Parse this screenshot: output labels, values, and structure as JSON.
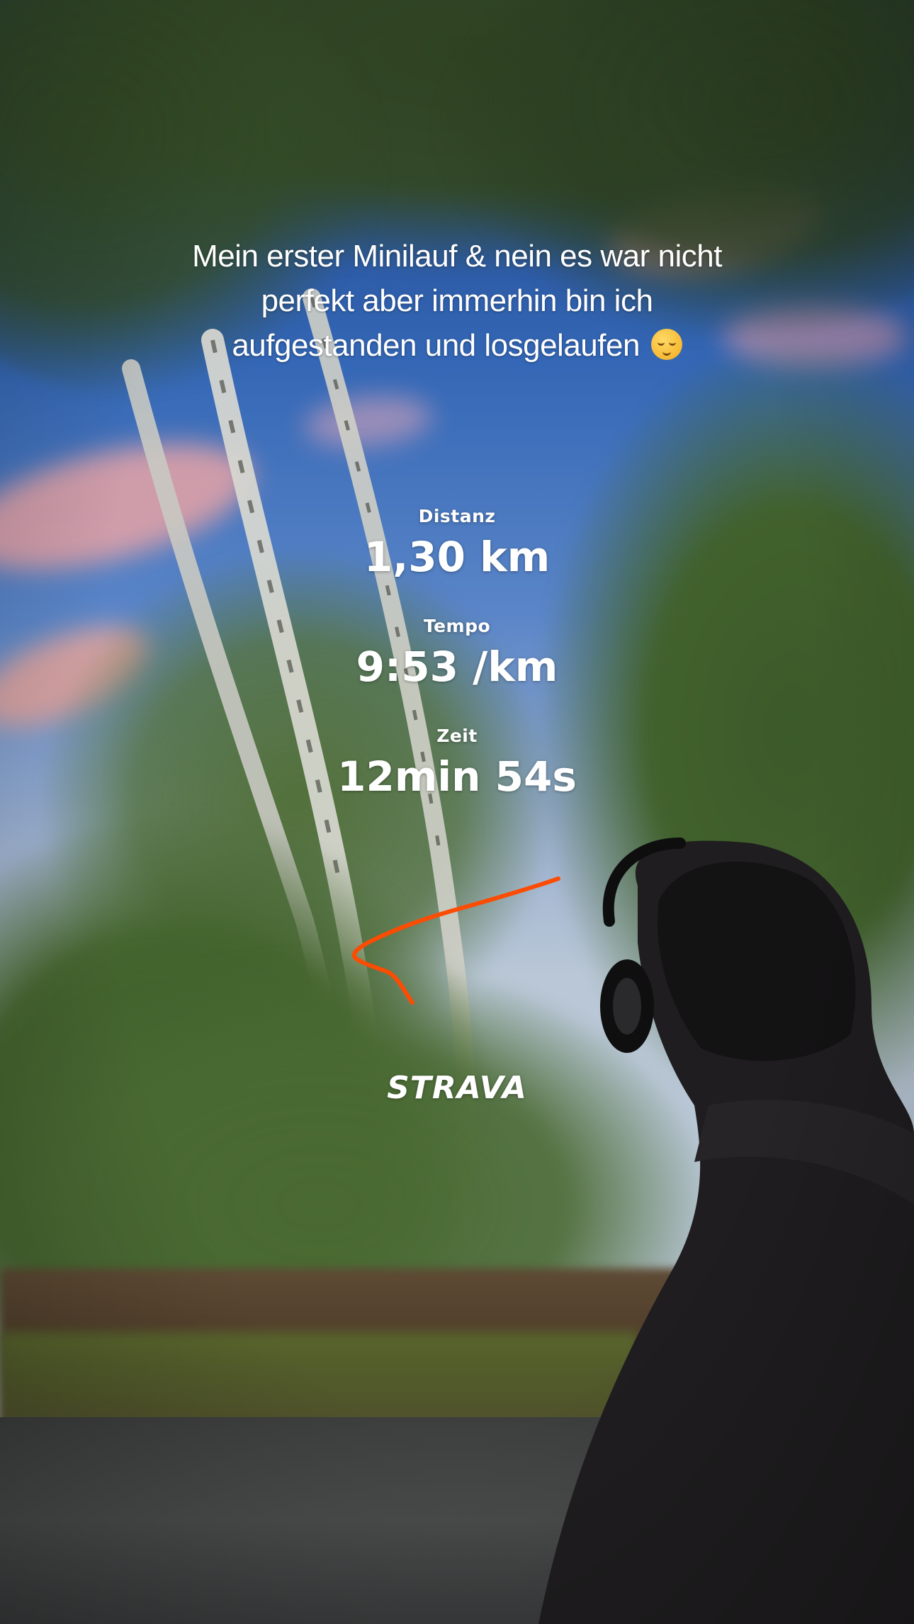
{
  "caption": {
    "line1": "Mein erster Minilauf & nein es war nicht",
    "line2": "perfekt aber immerhin bin ich",
    "line3": "aufgestanden und losgelaufen",
    "emoji": "relieved-face-emoji"
  },
  "stats": [
    {
      "label": "Distanz",
      "value": "1,30 km"
    },
    {
      "label": "Tempo",
      "value": "9:53 /km"
    },
    {
      "label": "Zeit",
      "value": "12min 54s"
    }
  ],
  "route": {
    "color": "#fc4c02"
  },
  "brand": {
    "name": "STRAVA",
    "color": "#ffffff"
  }
}
